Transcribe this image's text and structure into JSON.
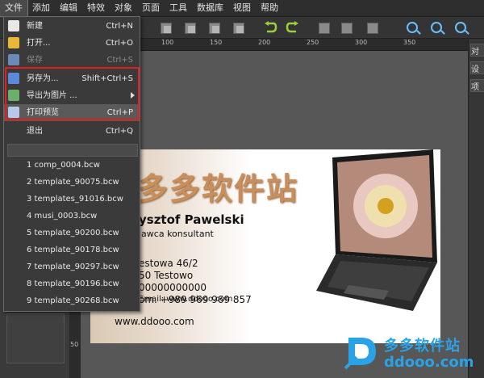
{
  "menubar": [
    "文件",
    "添加",
    "编辑",
    "特效",
    "对象",
    "页面",
    "工具",
    "数据库",
    "视图",
    "帮助"
  ],
  "file_menu": {
    "items": [
      {
        "label": "新建",
        "shortcut": "Ctrl+N",
        "icon": "new-file-icon",
        "enabled": true
      },
      {
        "label": "打开...",
        "shortcut": "Ctrl+O",
        "icon": "folder-open-icon",
        "enabled": true
      },
      {
        "label": "保存",
        "shortcut": "Ctrl+S",
        "icon": "save-icon",
        "enabled": false
      },
      {
        "label": "另存为...",
        "shortcut": "Shift+Ctrl+S",
        "icon": "save-as-icon",
        "enabled": true
      },
      {
        "label": "导出为图片 ...",
        "shortcut": "",
        "icon": "export-image-icon",
        "enabled": true,
        "submenu": true
      },
      {
        "label": "打印预览",
        "shortcut": "Ctrl+P",
        "icon": "print-preview-icon",
        "enabled": true,
        "highlighted": true
      },
      {
        "label": "退出",
        "shortcut": "Ctrl+Q",
        "icon": "",
        "enabled": true
      }
    ],
    "recent_files": [
      "1 comp_0004.bcw",
      "2 template_90075.bcw",
      "3 templates_91016.bcw",
      "4 musi_0003.bcw",
      "5 template_90200.bcw",
      "6 template_90178.bcw",
      "7 template_90297.bcw",
      "8 template_90196.bcw",
      "9 template_90268.bcw"
    ]
  },
  "ruler": {
    "top": [
      "100",
      "150",
      "200",
      "250",
      "300",
      "350"
    ],
    "left": [
      "50"
    ]
  },
  "right_panel": [
    "对",
    "设",
    "项"
  ],
  "card": {
    "site_name": "多多软件站",
    "name": "ysztof Pawelski",
    "role": "lawca konsultant",
    "address": [
      "estowa 46/2",
      "50 Testowo",
      "00000000000",
      "om. +989 969 969 857"
    ],
    "email": "Email: www.ddooo.com",
    "website": "www.ddooo.com"
  },
  "watermark": {
    "cn": "多多软件站",
    "en": "ddooo.com"
  },
  "colors": {
    "accent_highlight": "#e02020",
    "watermark": "#2aa3e6",
    "sitename": "#c88f5c"
  }
}
